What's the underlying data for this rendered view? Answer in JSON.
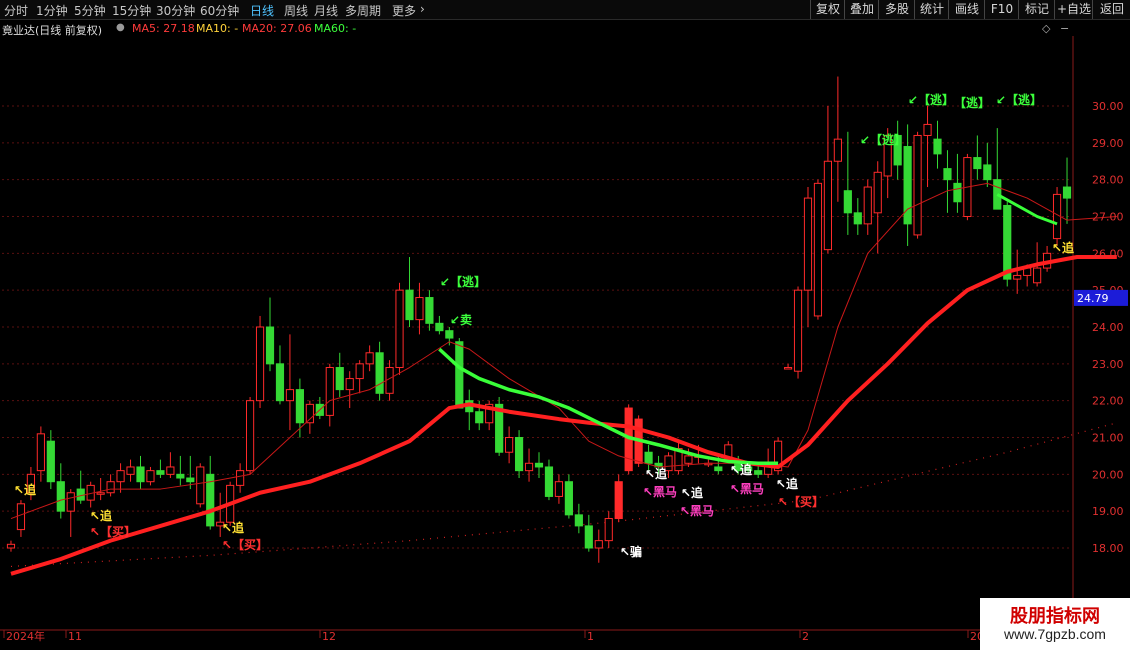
{
  "toolbar": {
    "timeframes": [
      "分时",
      "1分钟",
      "5分钟",
      "15分钟",
      "30分钟",
      "60分钟",
      "日线",
      "周线",
      "月线",
      "多周期",
      "更多"
    ],
    "active_timeframe": "日线",
    "right_buttons": [
      "复权",
      "叠加",
      "多股",
      "统计",
      "画线",
      "F10",
      "标记",
      "+自选",
      "返回"
    ]
  },
  "info": {
    "stock_title": "竟业达(日线 前复权)",
    "ma5": "MA5: 27.18",
    "ma10": "MA10: -",
    "ma20": "MA20: 27.06",
    "ma60": "MA60: -"
  },
  "colors": {
    "up": "#ff2a2a",
    "down": "#35d935",
    "ma20": "#ff2020",
    "ma60": "#39ff39",
    "price_box": "#1c1cd8"
  },
  "y_axis": {
    "ticks": [
      "30.00",
      "29.00",
      "28.00",
      "27.00",
      "26.00",
      "25.00",
      "24.00",
      "23.00",
      "22.00",
      "21.00",
      "20.00",
      "19.00",
      "18.00"
    ],
    "current_price": "24.79"
  },
  "x_axis": {
    "labels": [
      "2024年",
      "11",
      "12",
      "1",
      "2",
      "20"
    ]
  },
  "signals": {
    "zhui": "追",
    "mai": "【买】",
    "tao": "【逃】",
    "mai_sell": "卖",
    "hei_ma": "黑马",
    "pian": "骗"
  },
  "watermark": {
    "line1": "股朋指标网",
    "line2": "www.7gpzb.com"
  },
  "chart_data": {
    "type": "candlestick",
    "ylim": [
      17.2,
      31.0
    ],
    "candles": [
      [
        18.0,
        18.2,
        17.9,
        18.1
      ],
      [
        18.5,
        19.3,
        18.3,
        19.2
      ],
      [
        19.5,
        20.2,
        19.3,
        20.0
      ],
      [
        20.1,
        21.3,
        19.8,
        21.1
      ],
      [
        20.9,
        21.2,
        19.6,
        19.8
      ],
      [
        19.8,
        20.3,
        18.8,
        19.0
      ],
      [
        19.0,
        19.6,
        18.3,
        19.5
      ],
      [
        19.6,
        20.1,
        19.2,
        19.3
      ],
      [
        19.3,
        19.8,
        19.1,
        19.7
      ],
      [
        19.5,
        19.9,
        19.3,
        19.5
      ],
      [
        19.5,
        20.0,
        19.4,
        19.8
      ],
      [
        19.8,
        20.3,
        19.5,
        20.1
      ],
      [
        20.0,
        20.4,
        19.8,
        20.2
      ],
      [
        20.2,
        20.5,
        19.6,
        19.8
      ],
      [
        19.8,
        20.2,
        19.7,
        20.1
      ],
      [
        20.1,
        20.4,
        19.9,
        20.0
      ],
      [
        20.0,
        20.6,
        19.9,
        20.2
      ],
      [
        20.0,
        20.5,
        19.7,
        19.9
      ],
      [
        19.9,
        20.5,
        19.6,
        19.8
      ],
      [
        19.2,
        20.3,
        19.1,
        20.2
      ],
      [
        20.0,
        20.5,
        18.5,
        18.6
      ],
      [
        18.6,
        19.5,
        18.3,
        18.7
      ],
      [
        18.7,
        19.8,
        18.6,
        19.7
      ],
      [
        19.7,
        20.3,
        19.5,
        20.1
      ],
      [
        20.1,
        22.1,
        20.0,
        22.0
      ],
      [
        22.0,
        24.3,
        21.8,
        24.0
      ],
      [
        24.0,
        24.8,
        22.8,
        23.0
      ],
      [
        23.0,
        23.5,
        21.9,
        22.0
      ],
      [
        22.0,
        23.8,
        21.2,
        22.3
      ],
      [
        22.3,
        22.6,
        21.0,
        21.4
      ],
      [
        21.4,
        22.0,
        21.1,
        21.9
      ],
      [
        21.9,
        22.1,
        21.5,
        21.6
      ],
      [
        21.6,
        23.0,
        21.3,
        22.9
      ],
      [
        22.9,
        23.3,
        22.1,
        22.3
      ],
      [
        22.3,
        22.8,
        21.8,
        22.6
      ],
      [
        22.6,
        23.1,
        22.2,
        23.0
      ],
      [
        23.0,
        23.5,
        22.8,
        23.3
      ],
      [
        23.3,
        23.6,
        22.0,
        22.2
      ],
      [
        22.2,
        23.1,
        22.0,
        22.9
      ],
      [
        22.9,
        25.2,
        22.7,
        25.0
      ],
      [
        25.0,
        25.9,
        24.0,
        24.2
      ],
      [
        24.2,
        25.2,
        23.8,
        24.8
      ],
      [
        24.8,
        25.0,
        23.9,
        24.1
      ],
      [
        24.1,
        24.3,
        23.8,
        23.9
      ],
      [
        23.9,
        24.0,
        23.5,
        23.7
      ],
      [
        23.6,
        23.7,
        21.8,
        21.8
      ],
      [
        22.0,
        22.3,
        21.2,
        21.7
      ],
      [
        21.7,
        22.0,
        21.2,
        21.4
      ],
      [
        21.4,
        22.0,
        21.2,
        21.9
      ],
      [
        21.9,
        22.1,
        20.5,
        20.6
      ],
      [
        20.6,
        21.3,
        20.3,
        21.0
      ],
      [
        21.0,
        21.2,
        19.9,
        20.1
      ],
      [
        20.1,
        20.7,
        19.8,
        20.3
      ],
      [
        20.3,
        20.6,
        19.9,
        20.2
      ],
      [
        20.2,
        20.4,
        19.3,
        19.4
      ],
      [
        19.4,
        20.0,
        19.2,
        19.8
      ],
      [
        19.8,
        20.0,
        18.8,
        18.9
      ],
      [
        18.9,
        19.2,
        18.4,
        18.6
      ],
      [
        18.6,
        18.9,
        17.9,
        18.0
      ],
      [
        18.0,
        18.5,
        17.6,
        18.2
      ],
      [
        18.2,
        19.0,
        18.0,
        18.8
      ],
      [
        18.8,
        20.0,
        18.7,
        19.8
      ],
      [
        20.1,
        21.9,
        20.0,
        21.8
      ],
      [
        20.3,
        21.6,
        20.2,
        21.5
      ],
      [
        20.6,
        20.8,
        20.1,
        20.3
      ],
      [
        20.3,
        20.5,
        20.0,
        20.2
      ],
      [
        20.1,
        20.6,
        19.9,
        20.5
      ],
      [
        20.1,
        20.9,
        20.0,
        20.7
      ],
      [
        20.3,
        20.7,
        20.2,
        20.5
      ],
      [
        20.5,
        20.8,
        20.3,
        20.5
      ],
      [
        20.3,
        20.4,
        20.2,
        20.3
      ],
      [
        20.2,
        20.5,
        20.0,
        20.1
      ],
      [
        20.4,
        20.9,
        20.3,
        20.8
      ],
      [
        20.3,
        20.5,
        20.0,
        20.1
      ],
      [
        20.2,
        20.3,
        20.0,
        20.1
      ],
      [
        20.1,
        20.3,
        19.9,
        20.0
      ],
      [
        20.0,
        20.7,
        19.9,
        20.3
      ],
      [
        20.1,
        21.0,
        20.0,
        20.9
      ],
      [
        22.9,
        23.0,
        22.9,
        22.9
      ],
      [
        22.8,
        25.1,
        22.6,
        25.0
      ],
      [
        25.0,
        27.8,
        24.0,
        27.5
      ],
      [
        24.3,
        28.0,
        24.2,
        27.9
      ],
      [
        26.1,
        30.0,
        26.0,
        28.5
      ],
      [
        28.5,
        30.8,
        27.4,
        29.1
      ],
      [
        27.7,
        29.3,
        26.5,
        27.1
      ],
      [
        27.1,
        27.5,
        26.5,
        26.8
      ],
      [
        26.8,
        28.0,
        26.5,
        27.8
      ],
      [
        27.1,
        28.5,
        26.0,
        28.2
      ],
      [
        28.1,
        29.4,
        27.5,
        29.2
      ],
      [
        29.2,
        29.6,
        28.0,
        28.4
      ],
      [
        28.9,
        29.5,
        26.2,
        26.8
      ],
      [
        26.5,
        29.3,
        26.4,
        29.2
      ],
      [
        29.2,
        30.0,
        27.8,
        29.5
      ],
      [
        29.1,
        29.6,
        28.3,
        28.7
      ],
      [
        28.3,
        28.8,
        27.1,
        28.0
      ],
      [
        27.9,
        28.7,
        27.1,
        27.4
      ],
      [
        27.0,
        28.7,
        26.9,
        28.6
      ],
      [
        28.6,
        29.2,
        28.0,
        28.3
      ],
      [
        28.4,
        29.0,
        27.8,
        28.0
      ],
      [
        28.0,
        29.4,
        27.6,
        27.2
      ],
      [
        27.3,
        27.4,
        25.1,
        25.3
      ],
      [
        25.3,
        26.1,
        24.9,
        25.4
      ],
      [
        25.4,
        25.7,
        25.1,
        25.6
      ],
      [
        25.2,
        26.3,
        25.1,
        25.6
      ],
      [
        25.6,
        26.2,
        25.5,
        26.0
      ],
      [
        26.4,
        27.8,
        26.2,
        27.6
      ],
      [
        27.8,
        28.6,
        26.8,
        27.5
      ]
    ],
    "ma60": [
      [
        43,
        23.4
      ],
      [
        45,
        22.9
      ],
      [
        47,
        22.6
      ],
      [
        50,
        22.3
      ],
      [
        53,
        22.1
      ],
      [
        56,
        21.8
      ],
      [
        59,
        21.4
      ],
      [
        62,
        21.0
      ],
      [
        65,
        20.8
      ],
      [
        69,
        20.5
      ],
      [
        72,
        20.35
      ],
      [
        75,
        20.3
      ],
      [
        77,
        20.3
      ]
    ],
    "ma60b": [
      [
        99,
        27.6
      ],
      [
        101,
        27.3
      ],
      [
        103,
        27.0
      ],
      [
        105,
        26.8
      ]
    ],
    "ma20": [
      [
        0,
        17.3
      ],
      [
        5,
        17.7
      ],
      [
        10,
        18.2
      ],
      [
        15,
        18.6
      ],
      [
        20,
        19.0
      ],
      [
        25,
        19.5
      ],
      [
        30,
        19.8
      ],
      [
        35,
        20.3
      ],
      [
        40,
        20.9
      ],
      [
        44,
        21.8
      ],
      [
        46,
        21.9
      ],
      [
        50,
        21.7
      ],
      [
        55,
        21.5
      ],
      [
        58,
        21.4
      ],
      [
        62,
        21.3
      ],
      [
        66,
        21.0
      ],
      [
        70,
        20.6
      ],
      [
        74,
        20.3
      ],
      [
        77,
        20.2
      ],
      [
        80,
        20.8
      ],
      [
        84,
        22.0
      ],
      [
        88,
        23.0
      ],
      [
        92,
        24.1
      ],
      [
        96,
        25.0
      ],
      [
        100,
        25.5
      ],
      [
        103,
        25.7
      ],
      [
        107,
        25.9
      ],
      [
        111,
        25.9
      ]
    ],
    "ma10": [
      [
        0,
        18.8
      ],
      [
        5,
        19.3
      ],
      [
        10,
        19.6
      ],
      [
        15,
        19.6
      ],
      [
        20,
        19.8
      ],
      [
        24,
        20.0
      ],
      [
        28,
        21.0
      ],
      [
        32,
        22.0
      ],
      [
        36,
        22.3
      ],
      [
        40,
        22.9
      ],
      [
        44,
        23.6
      ],
      [
        46,
        23.4
      ],
      [
        50,
        22.6
      ],
      [
        55,
        21.8
      ],
      [
        58,
        20.9
      ],
      [
        61,
        20.5
      ],
      [
        65,
        20.2
      ],
      [
        70,
        20.3
      ],
      [
        75,
        20.3
      ],
      [
        78,
        20.2
      ],
      [
        80,
        21.2
      ],
      [
        83,
        24.0
      ],
      [
        86,
        26.0
      ],
      [
        90,
        27.2
      ],
      [
        94,
        27.7
      ],
      [
        98,
        27.9
      ],
      [
        102,
        27.5
      ],
      [
        106,
        26.9
      ],
      [
        111,
        27.0
      ]
    ],
    "ma_dotted": [
      [
        0,
        17.5
      ],
      [
        20,
        17.8
      ],
      [
        40,
        18.2
      ],
      [
        60,
        18.7
      ],
      [
        80,
        19.3
      ],
      [
        100,
        20.6
      ],
      [
        111,
        21.4
      ]
    ]
  }
}
